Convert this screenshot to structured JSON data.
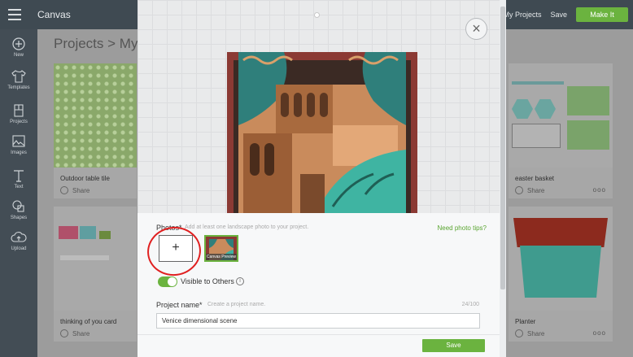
{
  "topbar": {
    "app_title": "Canvas",
    "links": [
      "My Projects",
      "Save"
    ],
    "make_label": "Make It"
  },
  "leftnav": {
    "items": [
      {
        "label": "New",
        "icon": "plus-circle-icon"
      },
      {
        "label": "Templates",
        "icon": "shirt-icon"
      },
      {
        "label": "Projects",
        "icon": "projects-icon"
      },
      {
        "label": "Images",
        "icon": "image-icon"
      },
      {
        "label": "Text",
        "icon": "text-icon"
      },
      {
        "label": "Shapes",
        "icon": "shapes-icon"
      },
      {
        "label": "Upload",
        "icon": "upload-icon"
      }
    ]
  },
  "page": {
    "breadcrumb": "Projects  >  My P",
    "cards": [
      {
        "title": "Outdoor table tile",
        "share": "Share"
      },
      {
        "title": "thinking of you card",
        "share": "Share"
      },
      {
        "title": "easter basket",
        "share": "Share",
        "more": "ooo"
      },
      {
        "title": "Planter",
        "share": "Share",
        "more": "ooo"
      }
    ]
  },
  "modal": {
    "close_label": "×",
    "photos_label": "Photos*",
    "photos_hint": "Add at least one landscape photo to your project.",
    "photo_tips": "Need photo tips?",
    "add_photo_label": "+",
    "thumb_label": "Canvas Preview",
    "visible_label": "Visible to Others",
    "info_label": "i",
    "project_name_label": "Project name*",
    "project_name_placeholder": "Create a project name.",
    "project_name_count": "24/100",
    "project_name_value": "Venice dimensional scene",
    "save_label": "Save"
  },
  "colors": {
    "accent": "#6bb33f",
    "topbar": "#3f4a52",
    "highlight_circle": "#e02020"
  }
}
